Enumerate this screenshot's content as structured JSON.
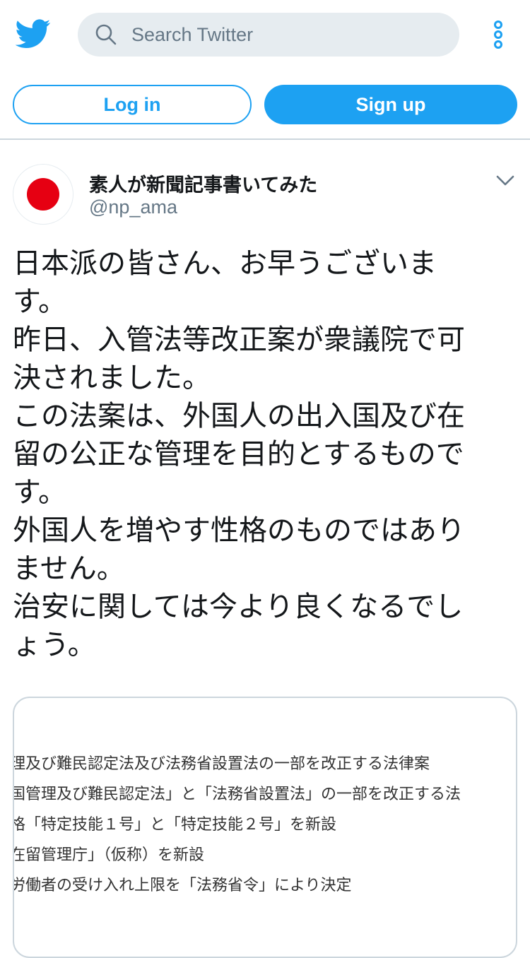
{
  "header": {
    "logo_icon": "twitter-bird-icon",
    "search_placeholder": "Search Twitter",
    "more_icon": "more-vertical-icon"
  },
  "auth": {
    "login_label": "Log in",
    "signup_label": "Sign up"
  },
  "tweet": {
    "display_name": "素人が新聞記事書いてみた",
    "handle": "@np_ama",
    "avatar_icon": "japan-flag-avatar",
    "menu_icon": "chevron-down-icon",
    "text_lines": [
      "日本派の皆さん、お早うございま",
      "す。",
      "昨日、入管法等改正案が衆議院で可",
      "決されました。",
      "この法案は、外国人の出入国及び在",
      "留の公正な管理を目的とするもので",
      "す。",
      "外国人を増やす性格のものではあり",
      "ません。",
      "治安に関しては今より良くなるでし",
      "ょう。"
    ],
    "media_lines": [
      "理及び難民認定法及び法務省設置法の一部を改正する法律案",
      "国管理及び難民認定法」と「法務省設置法」の一部を改正する法",
      "格「特定技能１号」と「特定技能２号」を新設",
      "在留管理庁」（仮称）を新設",
      "労働者の受け入れ上限を「法務省令」により決定"
    ]
  },
  "colors": {
    "brand_blue": "#1da1f2",
    "search_bg": "#e6ecf0",
    "secondary_text": "#657786",
    "avatar_red": "#e60012"
  }
}
